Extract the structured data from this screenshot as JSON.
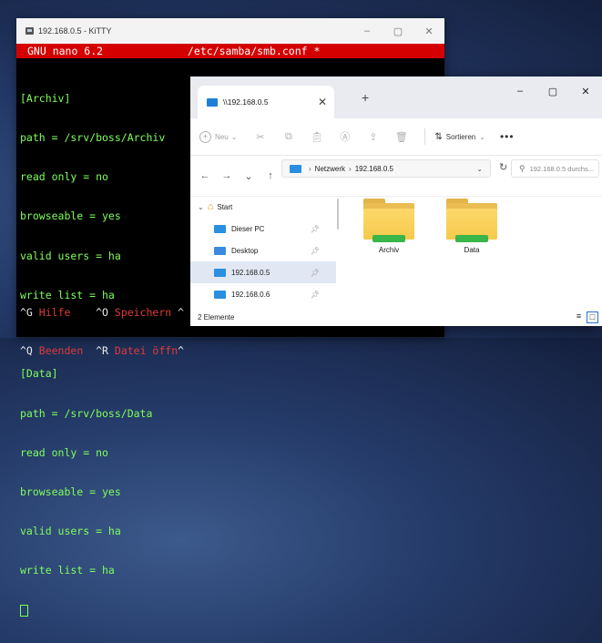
{
  "kitty": {
    "title": "192.168.0.5 - KiTTY",
    "controls": [
      "–",
      "▢",
      "✕"
    ],
    "nano_version": "GNU nano 6.2",
    "file": "/etc/samba/smb.conf *",
    "lines": [
      "[Archiv]",
      "path = /srv/boss/Archiv",
      "read only = no",
      "browseable = yes",
      "valid users = ha",
      "write list = ha",
      "",
      "[Data]",
      "path = /srv/boss/Data",
      "read only = no",
      "browseable = yes",
      "valid users = ha",
      "write list = ha"
    ],
    "help": {
      "r1": [
        {
          "key": "^G",
          "label": " Hilfe"
        },
        {
          "key": "^O",
          "label": " Speichern"
        },
        {
          "key": "^",
          "label": ""
        }
      ],
      "r2": [
        {
          "key": "^Q",
          "label": " Beenden"
        },
        {
          "key": "^R",
          "label": " Datei öffn"
        },
        {
          "key": "^",
          "label": ""
        }
      ]
    }
  },
  "explorer": {
    "tab_title": "\\\\192.168.0.5",
    "tab_close": "✕",
    "new_tab": "+",
    "window_controls": [
      "–",
      "▢",
      "✕"
    ],
    "commands": {
      "new": "Neu",
      "new_chevron": "⌄",
      "icons": [
        "cut-icon",
        "copy-icon",
        "paste-icon",
        "rename-icon",
        "share-icon",
        "delete-icon"
      ],
      "sort": "Sortieren",
      "sort_icon": "⇅",
      "more": "•••"
    },
    "nav": {
      "back": "←",
      "forward": "→",
      "recent": "⌄",
      "up": "↑"
    },
    "address": {
      "segments": [
        "Netzwerk",
        "192.168.0.5"
      ],
      "dropdown": "⌄",
      "refresh": "↻"
    },
    "search_placeholder": "192.168.0.5 durchs...",
    "sidebar": [
      {
        "label": "Start",
        "pinned": false,
        "selected": false
      },
      {
        "label": "Dieser PC",
        "pinned": true,
        "selected": false
      },
      {
        "label": "Desktop",
        "pinned": true,
        "selected": false
      },
      {
        "label": "192.168.0.5",
        "pinned": true,
        "selected": true
      },
      {
        "label": "192.168.0.6",
        "pinned": true,
        "selected": false
      }
    ],
    "folders": [
      "Archiv",
      "Data"
    ],
    "status": "2 Elemente"
  }
}
